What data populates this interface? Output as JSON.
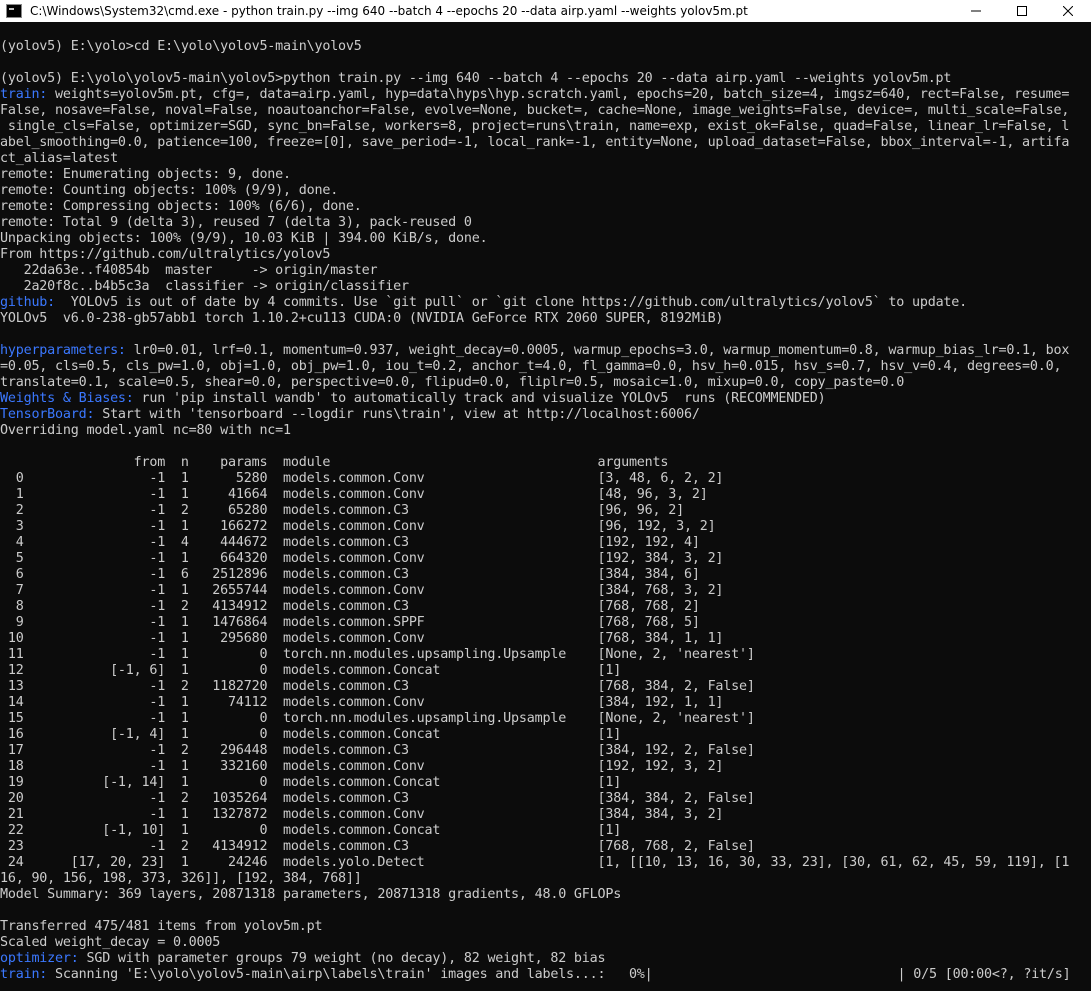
{
  "window": {
    "title": "C:\\Windows\\System32\\cmd.exe - python  train.py --img 640 --batch 4 --epochs 20 --data airp.yaml --weights yolov5m.pt",
    "minimize": "—",
    "maximize": "□",
    "close": "✕"
  },
  "colors": {
    "background": "#0c0c0c",
    "text": "#cccccc",
    "accent": "#3b78ff"
  },
  "lines": [
    {
      "t": ""
    },
    {
      "t": "(yolov5) E:\\yolo>cd E:\\yolo\\yolov5-main\\yolov5"
    },
    {
      "t": ""
    },
    {
      "t": "(yolov5) E:\\yolo\\yolov5-main\\yolov5>python train.py --img 640 --batch 4 --epochs 20 --data airp.yaml --weights yolov5m.pt"
    },
    {
      "p": "train:",
      "t": " weights=yolov5m.pt, cfg=, data=airp.yaml, hyp=data\\hyps\\hyp.scratch.yaml, epochs=20, batch_size=4, imgsz=640, rect=False, resume="
    },
    {
      "t": "False, nosave=False, noval=False, noautoanchor=False, evolve=None, bucket=, cache=None, image_weights=False, device=, multi_scale=False,"
    },
    {
      "t": " single_cls=False, optimizer=SGD, sync_bn=False, workers=8, project=runs\\train, name=exp, exist_ok=False, quad=False, linear_lr=False, l"
    },
    {
      "t": "abel_smoothing=0.0, patience=100, freeze=[0], save_period=-1, local_rank=-1, entity=None, upload_dataset=False, bbox_interval=-1, artifa"
    },
    {
      "t": "ct_alias=latest"
    },
    {
      "t": "remote: Enumerating objects: 9, done."
    },
    {
      "t": "remote: Counting objects: 100% (9/9), done."
    },
    {
      "t": "remote: Compressing objects: 100% (6/6), done."
    },
    {
      "t": "remote: Total 9 (delta 3), reused 7 (delta 3), pack-reused 0"
    },
    {
      "t": "Unpacking objects: 100% (9/9), 10.03 KiB | 394.00 KiB/s, done."
    },
    {
      "t": "From https://github.com/ultralytics/yolov5"
    },
    {
      "t": "   22da63e..f40854b  master     -> origin/master"
    },
    {
      "t": "   2a20f8c..b4b5c3a  classifier -> origin/classifier"
    },
    {
      "p": "github:",
      "t": "  YOLOv5 is out of date by 4 commits. Use `git pull` or `git clone https://github.com/ultralytics/yolov5` to update."
    },
    {
      "t": "YOLOv5  v6.0-238-gb57abb1 torch 1.10.2+cu113 CUDA:0 (NVIDIA GeForce RTX 2060 SUPER, 8192MiB)"
    },
    {
      "t": ""
    },
    {
      "p": "hyperparameters:",
      "t": " lr0=0.01, lrf=0.1, momentum=0.937, weight_decay=0.0005, warmup_epochs=3.0, warmup_momentum=0.8, warmup_bias_lr=0.1, box"
    },
    {
      "t": "=0.05, cls=0.5, cls_pw=1.0, obj=1.0, obj_pw=1.0, iou_t=0.2, anchor_t=4.0, fl_gamma=0.0, hsv_h=0.015, hsv_s=0.7, hsv_v=0.4, degrees=0.0,"
    },
    {
      "t": "translate=0.1, scale=0.5, shear=0.0, perspective=0.0, flipud=0.0, fliplr=0.5, mosaic=1.0, mixup=0.0, copy_paste=0.0"
    },
    {
      "p": "Weights & Biases:",
      "t": " run 'pip install wandb' to automatically track and visualize YOLOv5  runs (RECOMMENDED)"
    },
    {
      "p": "TensorBoard:",
      "t": " Start with 'tensorboard --logdir runs\\train', view at http://localhost:6006/"
    },
    {
      "t": "Overriding model.yaml nc=80 with nc=1"
    },
    {
      "t": ""
    },
    {
      "t": "                 from  n    params  module                                  arguments"
    },
    {
      "t": "  0                -1  1      5280  models.common.Conv                      [3, 48, 6, 2, 2]"
    },
    {
      "t": "  1                -1  1     41664  models.common.Conv                      [48, 96, 3, 2]"
    },
    {
      "t": "  2                -1  2     65280  models.common.C3                        [96, 96, 2]"
    },
    {
      "t": "  3                -1  1    166272  models.common.Conv                      [96, 192, 3, 2]"
    },
    {
      "t": "  4                -1  4    444672  models.common.C3                        [192, 192, 4]"
    },
    {
      "t": "  5                -1  1    664320  models.common.Conv                      [192, 384, 3, 2]"
    },
    {
      "t": "  6                -1  6   2512896  models.common.C3                        [384, 384, 6]"
    },
    {
      "t": "  7                -1  1   2655744  models.common.Conv                      [384, 768, 3, 2]"
    },
    {
      "t": "  8                -1  2   4134912  models.common.C3                        [768, 768, 2]"
    },
    {
      "t": "  9                -1  1   1476864  models.common.SPPF                      [768, 768, 5]"
    },
    {
      "t": " 10                -1  1    295680  models.common.Conv                      [768, 384, 1, 1]"
    },
    {
      "t": " 11                -1  1         0  torch.nn.modules.upsampling.Upsample    [None, 2, 'nearest']"
    },
    {
      "t": " 12           [-1, 6]  1         0  models.common.Concat                    [1]"
    },
    {
      "t": " 13                -1  2   1182720  models.common.C3                        [768, 384, 2, False]"
    },
    {
      "t": " 14                -1  1     74112  models.common.Conv                      [384, 192, 1, 1]"
    },
    {
      "t": " 15                -1  1         0  torch.nn.modules.upsampling.Upsample    [None, 2, 'nearest']"
    },
    {
      "t": " 16           [-1, 4]  1         0  models.common.Concat                    [1]"
    },
    {
      "t": " 17                -1  2    296448  models.common.C3                        [384, 192, 2, False]"
    },
    {
      "t": " 18                -1  1    332160  models.common.Conv                      [192, 192, 3, 2]"
    },
    {
      "t": " 19          [-1, 14]  1         0  models.common.Concat                    [1]"
    },
    {
      "t": " 20                -1  2   1035264  models.common.C3                        [384, 384, 2, False]"
    },
    {
      "t": " 21                -1  1   1327872  models.common.Conv                      [384, 384, 3, 2]"
    },
    {
      "t": " 22          [-1, 10]  1         0  models.common.Concat                    [1]"
    },
    {
      "t": " 23                -1  2   4134912  models.common.C3                        [768, 768, 2, False]"
    },
    {
      "t": " 24      [17, 20, 23]  1     24246  models.yolo.Detect                      [1, [[10, 13, 16, 30, 33, 23], [30, 61, 62, 45, 59, 119], [1"
    },
    {
      "t": "16, 90, 156, 198, 373, 326]], [192, 384, 768]]"
    },
    {
      "t": "Model Summary: 369 layers, 20871318 parameters, 20871318 gradients, 48.0 GFLOPs"
    },
    {
      "t": ""
    },
    {
      "t": "Transferred 475/481 items from yolov5m.pt"
    },
    {
      "t": "Scaled weight_decay = 0.0005"
    },
    {
      "p": "optimizer:",
      "t": " SGD with parameter groups 79 weight (no decay), 82 weight, 82 bias"
    }
  ],
  "scan_line": {
    "prefix": "train:",
    "text": " Scanning 'E:\\yolo\\yolov5-main\\airp\\labels\\train' images and labels...:   0%|",
    "bar_end": "| 0/5 [00:00<?, ?it/s]",
    "progress": 0
  }
}
